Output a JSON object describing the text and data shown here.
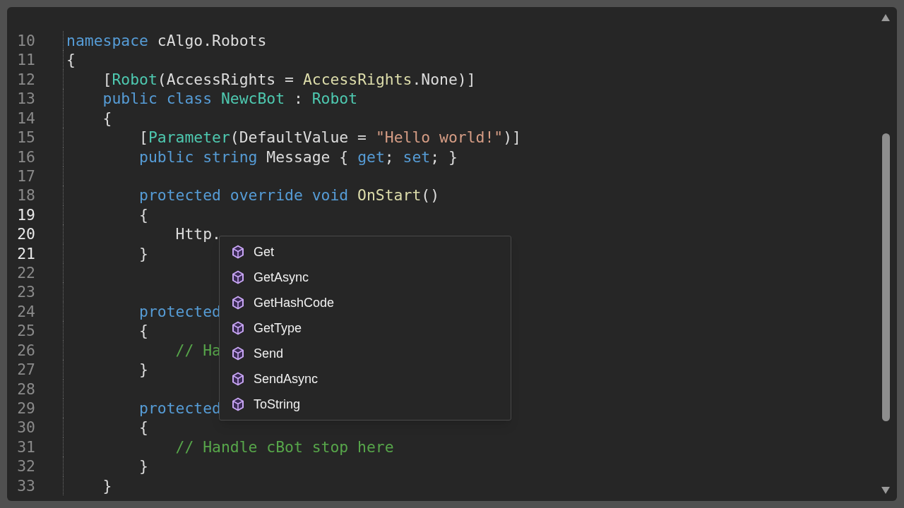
{
  "editor": {
    "lines": [
      {
        "number": "10",
        "current": false,
        "tokens": [
          {
            "text": "namespace",
            "kind": "keyword"
          },
          {
            "text": " cAlgo.Robots",
            "kind": "plain"
          }
        ]
      },
      {
        "number": "11",
        "current": false,
        "tokens": [
          {
            "text": "{",
            "kind": "plain"
          }
        ]
      },
      {
        "number": "12",
        "current": false,
        "tokens": [
          {
            "text": "    [",
            "kind": "plain"
          },
          {
            "text": "Robot",
            "kind": "type"
          },
          {
            "text": "(AccessRights = ",
            "kind": "plain"
          },
          {
            "text": "AccessRights",
            "kind": "method"
          },
          {
            "text": ".None)]",
            "kind": "plain"
          }
        ]
      },
      {
        "number": "13",
        "current": false,
        "tokens": [
          {
            "text": "    public class ",
            "kind": "keyword"
          },
          {
            "text": "NewcBot",
            "kind": "type"
          },
          {
            "text": " : ",
            "kind": "plain"
          },
          {
            "text": "Robot",
            "kind": "type"
          }
        ]
      },
      {
        "number": "14",
        "current": false,
        "tokens": [
          {
            "text": "    {",
            "kind": "plain"
          }
        ]
      },
      {
        "number": "15",
        "current": false,
        "tokens": [
          {
            "text": "        [",
            "kind": "plain"
          },
          {
            "text": "Parameter",
            "kind": "type"
          },
          {
            "text": "(DefaultValue = ",
            "kind": "plain"
          },
          {
            "text": "\"Hello world!\"",
            "kind": "string"
          },
          {
            "text": ")]",
            "kind": "plain"
          }
        ]
      },
      {
        "number": "16",
        "current": false,
        "tokens": [
          {
            "text": "        public string ",
            "kind": "keyword"
          },
          {
            "text": "Message { ",
            "kind": "plain"
          },
          {
            "text": "get",
            "kind": "keyword"
          },
          {
            "text": "; ",
            "kind": "plain"
          },
          {
            "text": "set",
            "kind": "keyword"
          },
          {
            "text": "; }",
            "kind": "plain"
          }
        ]
      },
      {
        "number": "17",
        "current": false
      },
      {
        "number": "18",
        "current": false,
        "tokens": [
          {
            "text": "        protected override void ",
            "kind": "keyword"
          },
          {
            "text": "OnStart",
            "kind": "method"
          },
          {
            "text": "()",
            "kind": "plain"
          }
        ]
      },
      {
        "number": "19",
        "current": true,
        "tokens": [
          {
            "text": "        {",
            "kind": "plain"
          }
        ]
      },
      {
        "number": "20",
        "current": true,
        "tokens": [
          {
            "text": "            Http.",
            "kind": "plain"
          }
        ]
      },
      {
        "number": "21",
        "current": true,
        "tokens": [
          {
            "text": "        }",
            "kind": "plain"
          }
        ]
      },
      {
        "number": "22",
        "current": false
      },
      {
        "number": "23",
        "current": false
      },
      {
        "number": "24",
        "current": false,
        "tokens": [
          {
            "text": "        protected",
            "kind": "keyword"
          }
        ]
      },
      {
        "number": "25",
        "current": false,
        "tokens": [
          {
            "text": "        {",
            "kind": "plain"
          }
        ]
      },
      {
        "number": "26",
        "current": false,
        "tokens": [
          {
            "text": "            // Ha",
            "kind": "comment"
          }
        ]
      },
      {
        "number": "27",
        "current": false,
        "tokens": [
          {
            "text": "        }",
            "kind": "plain"
          }
        ]
      },
      {
        "number": "28",
        "current": false
      },
      {
        "number": "29",
        "current": false,
        "tokens": [
          {
            "text": "        protected",
            "kind": "keyword"
          }
        ]
      },
      {
        "number": "30",
        "current": false,
        "tokens": [
          {
            "text": "        {",
            "kind": "plain"
          }
        ]
      },
      {
        "number": "31",
        "current": false,
        "tokens": [
          {
            "text": "            // Handle cBot stop here",
            "kind": "comment"
          }
        ]
      },
      {
        "number": "32",
        "current": false,
        "tokens": [
          {
            "text": "        }",
            "kind": "plain"
          }
        ]
      },
      {
        "number": "33",
        "current": false,
        "tokens": [
          {
            "text": "    }",
            "kind": "plain"
          }
        ]
      }
    ]
  },
  "completion": {
    "items": [
      {
        "label": "Get"
      },
      {
        "label": "GetAsync"
      },
      {
        "label": "GetHashCode"
      },
      {
        "label": "GetType"
      },
      {
        "label": "Send"
      },
      {
        "label": "SendAsync"
      },
      {
        "label": "ToString"
      }
    ]
  }
}
